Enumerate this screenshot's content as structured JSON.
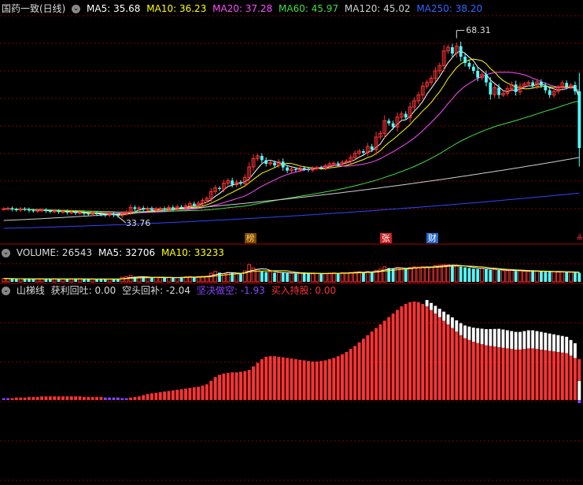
{
  "colors": {
    "up": "#ff3333",
    "down": "#54ffff",
    "ma5": "#ffffff",
    "ma10": "#ffff00",
    "ma20": "#ff4dff",
    "ma60": "#44dd44",
    "ma120": "#d0d0d0",
    "ma250": "#3344ff",
    "grid": "#8b0000",
    "hline": "#aa0000",
    "label_dim": "#bbbbbb"
  },
  "main_header": {
    "title": "国药一致(日线)",
    "ma5": "MA5: 35.68",
    "ma10": "MA10: 36.23",
    "ma20": "MA20: 37.28",
    "ma60": "MA60: 45.97",
    "ma120": "MA120: 45.02",
    "ma250": "MA250: 38.20"
  },
  "volume_header": {
    "label": "VOLUME: 26543",
    "ma5": "MA5: 32706",
    "ma10": "MA10: 33233"
  },
  "indicator_header": {
    "name": "山梯线",
    "profit": "获利回吐: 0.00",
    "short_cover": "空头回补: -2.04",
    "short": "坚决做空: -1.93",
    "buy_hold": "买入持股: 0.00"
  },
  "annotations": {
    "high_label": "68.31",
    "low_label": "33.76"
  },
  "event_tags": [
    {
      "text": "榜",
      "color": "#ffcc66",
      "bg": "#7a4a00",
      "idx": 58
    },
    {
      "text": "张",
      "color": "#ffffff",
      "bg": "#cc2222",
      "idx": 90
    },
    {
      "text": "财",
      "color": "#ffffff",
      "bg": "#2266cc",
      "idx": 101
    },
    {
      "text": "≗",
      "color": "#ff3333",
      "bg": "transparent",
      "idx": 136
    }
  ],
  "chart_data": [
    {
      "type": "candlestick",
      "series_name": "国药一致(日线)",
      "price_range": [
        30,
        72
      ],
      "n_days": 137,
      "closes": [
        35.2,
        35.3,
        35.1,
        35.0,
        35.2,
        35.1,
        34.9,
        34.8,
        34.9,
        35.0,
        34.8,
        34.7,
        34.8,
        34.6,
        34.7,
        34.5,
        34.6,
        34.4,
        34.5,
        34.3,
        34.2,
        34.4,
        34.2,
        34.1,
        34.0,
        34.2,
        34.0,
        33.9,
        34.3,
        34.6,
        35.5,
        35.2,
        35.4,
        35.1,
        35.3,
        35.0,
        35.2,
        35.3,
        35.1,
        35.5,
        35.2,
        35.6,
        35.4,
        35.8,
        36.2,
        35.9,
        36.3,
        36.8,
        37.2,
        38.5,
        39.2,
        39.0,
        40.1,
        40.6,
        39.8,
        40.3,
        40.0,
        41.2,
        43.2,
        44.8,
        45.3,
        44.5,
        43.8,
        44.0,
        43.5,
        44.2,
        43.1,
        42.5,
        42.8,
        42.6,
        43.0,
        42.8,
        42.6,
        42.9,
        43.1,
        43.0,
        43.4,
        43.8,
        43.9,
        43.7,
        44.1,
        44.3,
        45.0,
        45.8,
        46.2,
        45.9,
        47.1,
        46.5,
        48.9,
        49.6,
        52.0,
        51.5,
        50.8,
        52.7,
        53.3,
        52.6,
        54.6,
        55.8,
        56.9,
        58.6,
        59.3,
        60.1,
        61.5,
        62.5,
        65.3,
        66.0,
        64.8,
        66.2,
        64.2,
        63.0,
        62.3,
        61.5,
        60.2,
        60.8,
        59.3,
        57.0,
        58.3,
        56.9,
        57.2,
        58.1,
        58.9,
        57.5,
        58.6,
        59.0,
        59.3,
        58.6,
        59.4,
        58.7,
        57.8,
        56.9,
        57.6,
        58.3,
        59.2,
        58.5,
        58.8,
        57.6,
        46.8
      ],
      "high": 68.31,
      "low": 33.76,
      "moving_averages": [
        {
          "name": "MA5",
          "last": 35.68
        },
        {
          "name": "MA10",
          "last": 36.23
        },
        {
          "name": "MA20",
          "last": 37.28
        },
        {
          "name": "MA60",
          "last": 45.97
        },
        {
          "name": "MA120",
          "last": 45.02
        },
        {
          "name": "MA250",
          "last": 38.2
        }
      ]
    },
    {
      "type": "bar",
      "series_name": "VOLUME",
      "last": 26543,
      "ma5": 32706,
      "ma10": 33233,
      "values": [
        30,
        28,
        26,
        25,
        27,
        24,
        26,
        25,
        27,
        26,
        24,
        25,
        26,
        24,
        25,
        27,
        24,
        26,
        25,
        24,
        23,
        25,
        24,
        26,
        24,
        23,
        25,
        24,
        40,
        45,
        55,
        40,
        38,
        42,
        35,
        40,
        38,
        36,
        34,
        38,
        40,
        36,
        42,
        44,
        46,
        40,
        45,
        48,
        50,
        75,
        90,
        80,
        70,
        82,
        78,
        72,
        68,
        95,
        150,
        120,
        110,
        90,
        85,
        88,
        80,
        82,
        78,
        76,
        74,
        72,
        76,
        74,
        72,
        70,
        74,
        72,
        70,
        76,
        78,
        74,
        80,
        78,
        82,
        86,
        88,
        84,
        90,
        86,
        100,
        110,
        130,
        120,
        115,
        125,
        118,
        112,
        124,
        130,
        128,
        132,
        130,
        126,
        140,
        145,
        150,
        148,
        140,
        138,
        132,
        126,
        120,
        115,
        112,
        118,
        110,
        104,
        108,
        102,
        98,
        96,
        100,
        94,
        96,
        92,
        90,
        94,
        92,
        88,
        86,
        90,
        88,
        84,
        86,
        82,
        84,
        80,
        78
      ]
    },
    {
      "type": "bar",
      "series_name": "山梯线",
      "values": {
        "获利回吐": 0.0,
        "空头回补": -2.04,
        "坚决做空": -1.93,
        "买入持股": 0.0
      },
      "bars": [
        3,
        3,
        3,
        4,
        4,
        4,
        5,
        5,
        5,
        6,
        6,
        6,
        6,
        6,
        6,
        6,
        6,
        6,
        6,
        5,
        5,
        5,
        5,
        5,
        4,
        4,
        4,
        4,
        3,
        3,
        4,
        5,
        6,
        8,
        10,
        11,
        12,
        13,
        14,
        15,
        16,
        17,
        18,
        19,
        20,
        21,
        22,
        24,
        26,
        32,
        38,
        42,
        44,
        45,
        46,
        46,
        47,
        48,
        50,
        56,
        62,
        68,
        72,
        73,
        73,
        72,
        71,
        70,
        69,
        68,
        67,
        66,
        65,
        64,
        64,
        65,
        66,
        68,
        70,
        73,
        76,
        80,
        85,
        90,
        96,
        102,
        108,
        114,
        120,
        126,
        132,
        138,
        144,
        150,
        156,
        160,
        163,
        164,
        163,
        160,
        156,
        150,
        144,
        138,
        132,
        126,
        120,
        114,
        108,
        103,
        100,
        97,
        95,
        93,
        91,
        90,
        89,
        88,
        87,
        86,
        85,
        84,
        84,
        85,
        86,
        86,
        85,
        84,
        83,
        82,
        81,
        80,
        79,
        78,
        74,
        70,
        68
      ],
      "tops_white": [
        0,
        0,
        0,
        0,
        0,
        0,
        0,
        0,
        0,
        0,
        0,
        0,
        0,
        0,
        0,
        0,
        0,
        0,
        0,
        0,
        0,
        0,
        0,
        0,
        0,
        0,
        0,
        0,
        0,
        0,
        0,
        0,
        0,
        0,
        0,
        0,
        0,
        0,
        0,
        0,
        0,
        0,
        0,
        0,
        0,
        0,
        0,
        0,
        0,
        0,
        0,
        0,
        0,
        0,
        0,
        0,
        0,
        0,
        0,
        0,
        0,
        0,
        0,
        0,
        0,
        0,
        0,
        0,
        0,
        0,
        0,
        0,
        0,
        0,
        0,
        0,
        0,
        0,
        0,
        0,
        0,
        0,
        0,
        0,
        0,
        0,
        0,
        0,
        0,
        0,
        0,
        0,
        0,
        0,
        0,
        0,
        0,
        0,
        0,
        0,
        0,
        0,
        0,
        0,
        0,
        0,
        0,
        0,
        0,
        0,
        0,
        0,
        0,
        0,
        0,
        0,
        0,
        0,
        0,
        0,
        0,
        0,
        0,
        0,
        0,
        0,
        0,
        0,
        0,
        0,
        0,
        0,
        0,
        0,
        0,
        0,
        0
      ]
    }
  ]
}
